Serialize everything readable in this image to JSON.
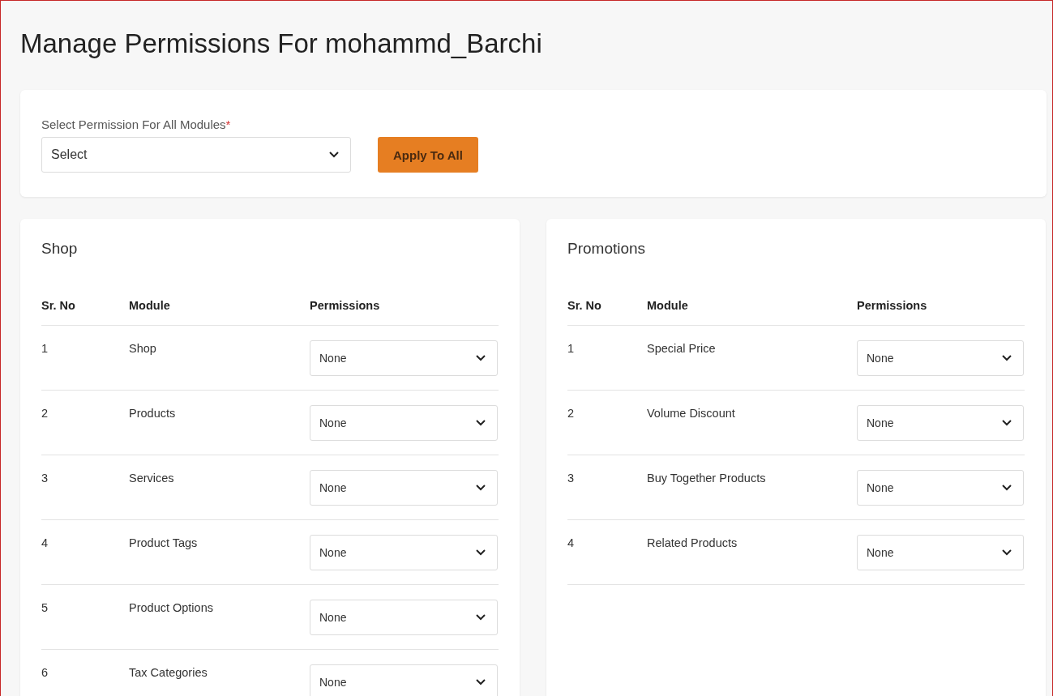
{
  "page_title": "Manage Permissions For mohammd_Barchi",
  "bulk": {
    "label": "Select Permission For All Modules",
    "required_mark": "*",
    "select_value": "Select",
    "button": "Apply To All"
  },
  "panels": [
    {
      "title": "Shop",
      "columns": [
        "Sr. No",
        "Module",
        "Permissions"
      ],
      "rows": [
        {
          "sr": "1",
          "module": "Shop",
          "permission": "None"
        },
        {
          "sr": "2",
          "module": "Products",
          "permission": "None"
        },
        {
          "sr": "3",
          "module": "Services",
          "permission": "None"
        },
        {
          "sr": "4",
          "module": "Product Tags",
          "permission": "None"
        },
        {
          "sr": "5",
          "module": "Product Options",
          "permission": "None"
        },
        {
          "sr": "6",
          "module": "Tax Categories",
          "permission": "None"
        }
      ]
    },
    {
      "title": "Promotions",
      "columns": [
        "Sr. No",
        "Module",
        "Permissions"
      ],
      "rows": [
        {
          "sr": "1",
          "module": "Special Price",
          "permission": "None"
        },
        {
          "sr": "2",
          "module": "Volume Discount",
          "permission": "None"
        },
        {
          "sr": "3",
          "module": "Buy Together Products",
          "permission": "None"
        },
        {
          "sr": "4",
          "module": "Related Products",
          "permission": "None"
        }
      ]
    }
  ]
}
